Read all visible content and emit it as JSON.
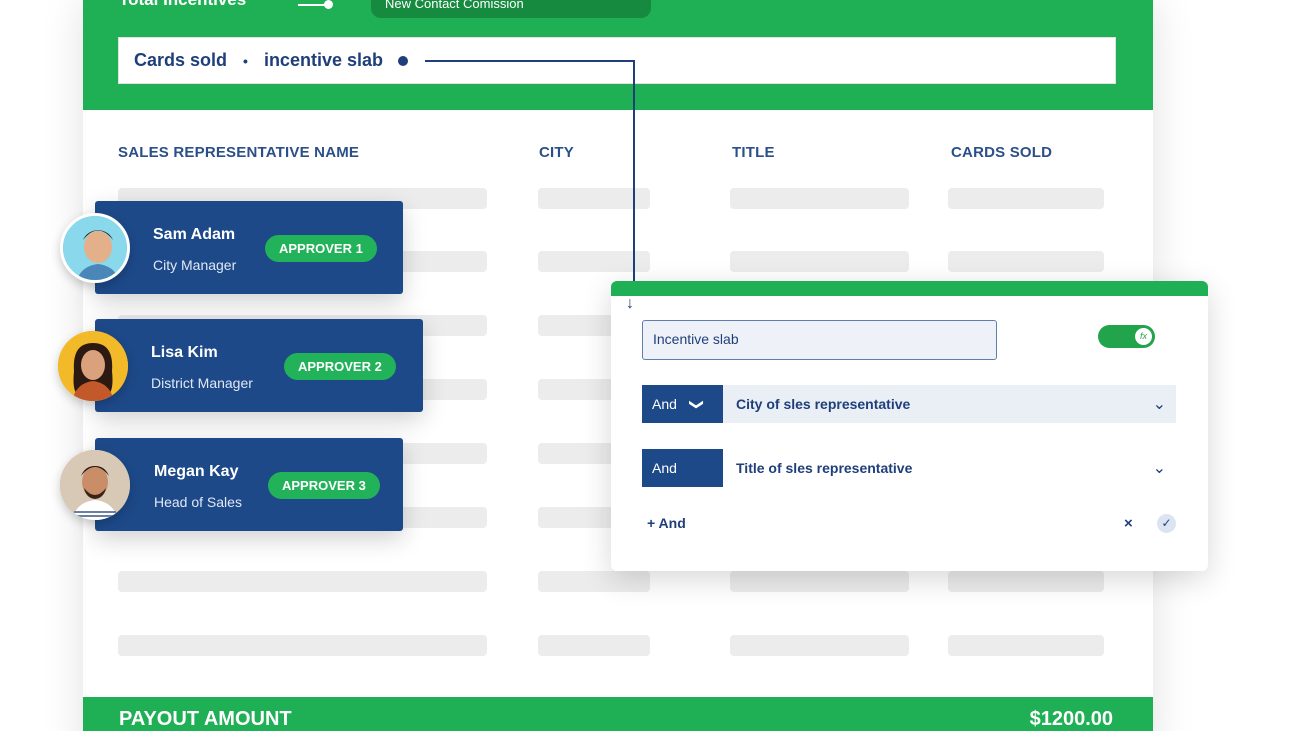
{
  "header": {
    "title": "Total Incentives",
    "tag": "New  Contact Comission",
    "formula": {
      "part1": "Cards sold",
      "separator": "•",
      "part2": "incentive slab"
    }
  },
  "table": {
    "columns": [
      "SALES REPRESENTATIVE NAME",
      "CITY",
      "TITLE",
      "CARDS SOLD"
    ]
  },
  "footer": {
    "label": "PAYOUT AMOUNT",
    "amount": "$1200.00"
  },
  "approvers": [
    {
      "name": "Sam Adam",
      "role": "City Manager",
      "badge": "APPROVER 1"
    },
    {
      "name": "Lisa Kim",
      "role": "District Manager",
      "badge": "APPROVER 2"
    },
    {
      "name": "Megan Kay",
      "role": "Head of Sales",
      "badge": "APPROVER 3"
    }
  ],
  "popup": {
    "name_value": "Incentive slab",
    "toggle_on": true,
    "toggle_icon": "fx",
    "conditions": [
      {
        "operator": "And",
        "field": "City of sles representative"
      },
      {
        "operator": "And",
        "field": "Title of sles representative"
      }
    ],
    "add_label": "+ And",
    "cancel_glyph": "×",
    "confirm_glyph": "✓"
  },
  "colors": {
    "brand_green": "#1faf55",
    "navy": "#1d4989",
    "text_navy": "#1f3f7a"
  }
}
